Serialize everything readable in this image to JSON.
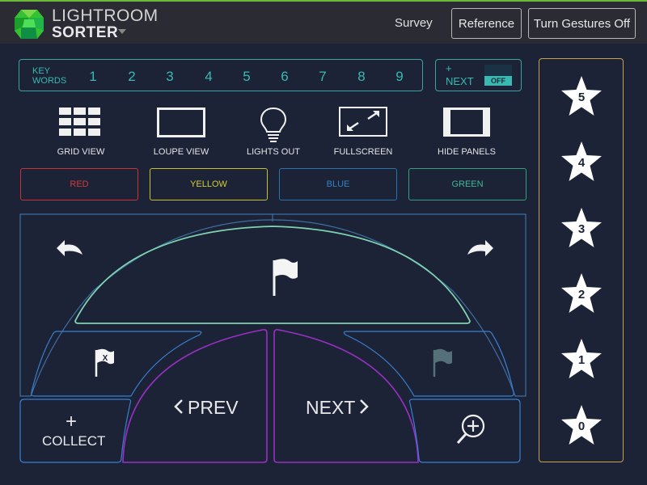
{
  "header": {
    "brand_line1": "LIGHTROOM",
    "brand_line2": "SORTER",
    "survey_label": "Survey",
    "reference_label": "Reference",
    "gestures_label": "Turn Gestures Off"
  },
  "keywords": {
    "label_line1": "KEY",
    "label_line2": "WORDS",
    "numbers": [
      "1",
      "2",
      "3",
      "4",
      "5",
      "6",
      "7",
      "8",
      "9"
    ]
  },
  "next_toggle": {
    "plus": "+",
    "label": "NEXT",
    "state": "OFF"
  },
  "tools": [
    {
      "label": "GRID VIEW",
      "icon": "grid-icon"
    },
    {
      "label": "LOUPE VIEW",
      "icon": "loupe-icon"
    },
    {
      "label": "LIGHTS OUT",
      "icon": "lightbulb-icon"
    },
    {
      "label": "FULLSCREEN",
      "icon": "fullscreen-icon"
    },
    {
      "label": "HIDE PANELS",
      "icon": "panels-icon"
    }
  ],
  "color_labels": [
    {
      "label": "RED",
      "color": "#d0383a"
    },
    {
      "label": "YELLOW",
      "color": "#c8c030"
    },
    {
      "label": "BLUE",
      "color": "#2a78b0"
    },
    {
      "label": "GREEN",
      "color": "#3aa888"
    }
  ],
  "controls": {
    "collect_plus": "+",
    "collect_label": "COLLECT",
    "prev_label": "PREV",
    "next_label": "NEXT",
    "reject_flag_mark": "X"
  },
  "ratings": [
    "5",
    "4",
    "3",
    "2",
    "1",
    "0"
  ],
  "colors": {
    "background": "#1c2337",
    "topbar": "#2a2b33",
    "teal": "#39b9b1",
    "gold": "#c8a14a",
    "purple": "#8a2fb0",
    "blue_outline": "#3a7fd0",
    "flag_arc": "#7fd3b0"
  }
}
